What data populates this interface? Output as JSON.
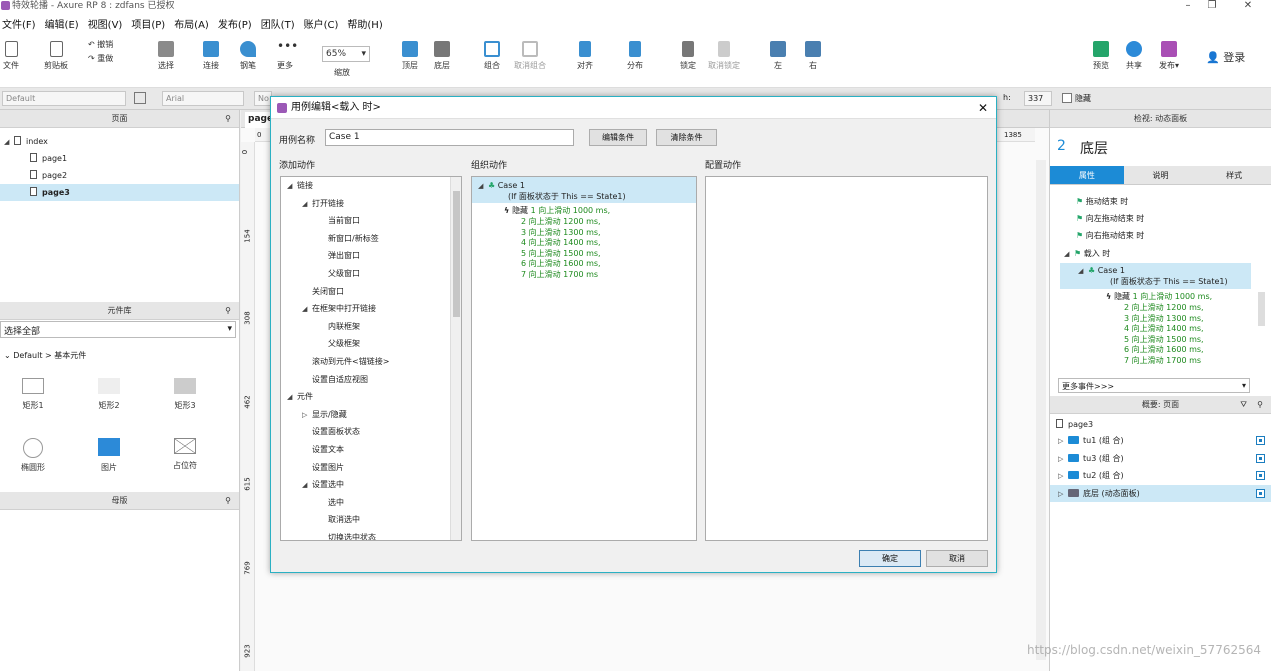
{
  "window": {
    "title": "特效轮播 - Axure RP 8 : zdfans 已授权"
  },
  "menu": [
    "文件(F)",
    "编辑(E)",
    "视图(V)",
    "项目(P)",
    "布局(A)",
    "发布(P)",
    "团队(T)",
    "账户(C)",
    "帮助(H)"
  ],
  "toolbar": {
    "file": "文件",
    "clipboard": "剪贴板",
    "undo": "撤销",
    "redo": "重做",
    "select": "选择",
    "connect": "连接",
    "pen": "钢笔",
    "more": "更多",
    "zoom_value": "65%",
    "zoom_label": "缩放",
    "top": "顶层",
    "bottom": "底层",
    "group": "组合",
    "ungroup": "取消组合",
    "align": "对齐",
    "distribute": "分布",
    "lock": "锁定",
    "unlock": "取消锁定",
    "left": "左",
    "right": "右",
    "preview": "预览",
    "share": "共享",
    "publish": "发布",
    "login": "登录"
  },
  "formatbar": {
    "style": "Default",
    "font": "Arial",
    "font_style": "No",
    "h_label": "h:",
    "h_value": "337",
    "hidden_label": "隐藏"
  },
  "pages_panel": {
    "title": "页面",
    "items": [
      "index",
      "page1",
      "page2",
      "page3"
    ]
  },
  "library_panel": {
    "title": "元件库",
    "selector": "选择全部",
    "group": "Default > 基本元件",
    "widgets": [
      "矩形1",
      "矩形2",
      "矩形3",
      "椭圆形",
      "图片",
      "占位符"
    ]
  },
  "masters_panel": {
    "title": "母版"
  },
  "canvas": {
    "tab": "page",
    "ruler_top_end": "1385",
    "ruler_left": [
      "0",
      "154",
      "308",
      "462",
      "615",
      "769",
      "923"
    ]
  },
  "dialog": {
    "title": "用例编辑<载入 时>",
    "case_name_label": "用例名称",
    "case_name_value": "Case 1",
    "edit_condition": "编辑条件",
    "clear_condition": "清除条件",
    "add_action_label": "添加动作",
    "organize_label": "组织动作",
    "configure_label": "配置动作",
    "add_actions": [
      {
        "text": "链接",
        "level": 0,
        "expand": true
      },
      {
        "text": "打开链接",
        "level": 1,
        "expand": true
      },
      {
        "text": "当前窗口",
        "level": 2
      },
      {
        "text": "新窗口/新标签",
        "level": 2
      },
      {
        "text": "弹出窗口",
        "level": 2
      },
      {
        "text": "父级窗口",
        "level": 2
      },
      {
        "text": "关闭窗口",
        "level": 1
      },
      {
        "text": "在框架中打开链接",
        "level": 1,
        "expand": true
      },
      {
        "text": "内联框架",
        "level": 2
      },
      {
        "text": "父级框架",
        "level": 2
      },
      {
        "text": "滚动到元件<锚链接>",
        "level": 1
      },
      {
        "text": "设置自适应视图",
        "level": 1
      },
      {
        "text": "元件",
        "level": 0,
        "expand": true
      },
      {
        "text": "显示/隐藏",
        "level": 1,
        "collapsed": true
      },
      {
        "text": "设置面板状态",
        "level": 1
      },
      {
        "text": "设置文本",
        "level": 1
      },
      {
        "text": "设置图片",
        "level": 1
      },
      {
        "text": "设置选中",
        "level": 1,
        "expand": true
      },
      {
        "text": "选中",
        "level": 2
      },
      {
        "text": "取消选中",
        "level": 2
      },
      {
        "text": "切换选中状态",
        "level": 2
      }
    ],
    "organize": {
      "case": "Case 1",
      "condition": "(If 面板状态于 This == State1)",
      "action_prefix": "隐藏",
      "lines": [
        "1 向上滑动 1000 ms,",
        "2 向上滑动 1200 ms,",
        "3 向上滑动 1300 ms,",
        "4 向上滑动 1400 ms,",
        "5 向上滑动 1500 ms,",
        "6 向上滑动 1600 ms,",
        "7 向上滑动 1700 ms"
      ]
    },
    "ok": "确定",
    "cancel": "取消"
  },
  "inspector": {
    "title": "检视: 动态面板",
    "number": "2",
    "name": "底层",
    "tabs": [
      "属性",
      "说明",
      "样式"
    ],
    "events": [
      "拖动结束 时",
      "向左拖动结束 时",
      "向右拖动结束 时",
      "载入 时"
    ],
    "case": "Case 1",
    "condition": "(If 面板状态于 This == State1)",
    "action_prefix": "隐藏",
    "lines": [
      "1 向上滑动 1000 ms,",
      "2 向上滑动 1200 ms,",
      "3 向上滑动 1300 ms,",
      "4 向上滑动 1400 ms,",
      "5 向上滑动 1500 ms,",
      "6 向上滑动 1600 ms,",
      "7 向上滑动 1700 ms"
    ],
    "more_events": "更多事件>>>"
  },
  "outline": {
    "title": "概要: 页面",
    "page": "page3",
    "items": [
      "tu1 (组 合)",
      "tu3 (组 合)",
      "tu2 (组 合)",
      "底层 (动态面板)"
    ]
  },
  "watermark": "https://blog.csdn.net/weixin_57762564",
  "colors": {
    "accent": "#1c8bd6",
    "dialog_border": "#2ab0c3",
    "action_green": "#1e8a1e",
    "selection": "#cce8f6"
  }
}
